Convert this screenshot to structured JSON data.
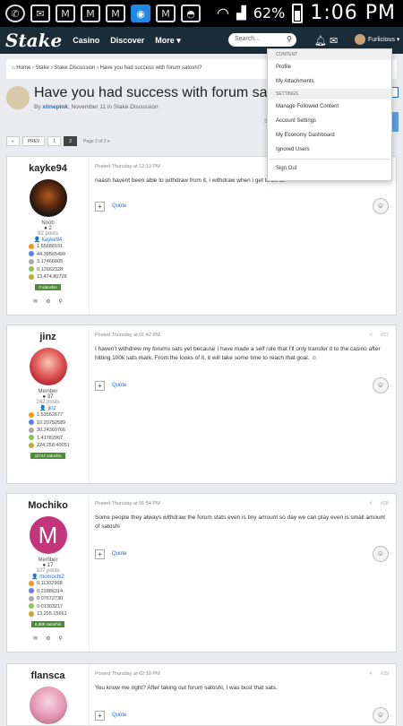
{
  "status_bar": {
    "icons": [
      "whatsapp-icon",
      "email-icon",
      "gmail-icon",
      "gmail-icon",
      "gmail-icon",
      "app-icon",
      "gmail-icon",
      "incognito-icon"
    ],
    "battery": "62%",
    "time": "1:06 PM"
  },
  "nav": {
    "logo": "Stake",
    "links": [
      "Casino",
      "Discover",
      "More ▾"
    ],
    "search_placeholder": "Search...",
    "username": "Furlicious ▾"
  },
  "dropdown": {
    "header_content": "CONTENT",
    "items_content": [
      "Profile",
      "My Attachments"
    ],
    "header_settings": "SETTINGS",
    "items_settings": [
      "Manage Followed Content",
      "Account Settings",
      "My Economy Dashboard",
      "Ignored Users"
    ],
    "signout": "Sign Out"
  },
  "breadcrumb": "⌂ Home  ›  Stake  ›  Stake Discussion  ›  Have you had success with forum satoshi?",
  "thread": {
    "title": "Have you had success with forum satoshi?",
    "by": "By ",
    "author": "xtinepink",
    "meta": ", November 11 in Stake Discussion",
    "ghost_s": "S"
  },
  "pagination": {
    "prev": "PREV",
    "pages": [
      "1",
      "2"
    ],
    "info": "Page 2 of 2 ▾",
    "back": "«"
  },
  "posts": [
    {
      "user": "kayke94",
      "role": "Noob",
      "rep": "● 2",
      "posts": "92 posts",
      "link": "kayke94",
      "crypto": [
        "1.65688191",
        "44.38565499",
        "3.17466005",
        "0.12662328",
        "13,474.80726"
      ],
      "sats": "0 satoshis",
      "time": "Posted Thursday at 12:19 PM",
      "body": "naash havent been able to withdraw from it, i withdraw when i get to 2k lol",
      "quote": "Quote",
      "num": "",
      "share": ""
    },
    {
      "user": "jinz",
      "role": "Member",
      "rep": "● 37",
      "posts": "242 posts",
      "link": "jinz",
      "crypto": [
        "1.53562677",
        "10.20750589",
        "30.24369766",
        "1.41782967",
        "224,258.40051"
      ],
      "sats": "42742 satoshis",
      "time": "Posted Thursday at 01:42 PM",
      "body": "I haven't withdrew my forums sats yet because I have made a self rule that I'll only transfer it to the casino after hitting 100k sats mark. From the looks of it, it will take some time to reach that goal. ☺",
      "quote": "Quote",
      "num": "#27",
      "share": "<"
    },
    {
      "user": "Mochiko",
      "role": "Member",
      "rep": "● 17",
      "posts": "127 posts",
      "link": "momochi2",
      "crypto": [
        "0.11302908",
        "0.22886314",
        "0.07672730",
        "0.01303217",
        "13,255.15661"
      ],
      "sats": "6,989 satoshis",
      "time": "Posted Thursday at 01:54 PM",
      "body": "Some people they always withdraw the forum stats even is tiny amount so day we can play even is small amount of satoshi",
      "quote": "Quote",
      "num": "#28",
      "share": "<"
    },
    {
      "user": "flansca",
      "time": "Posted Thursday at 02:10 PM",
      "body": "You know me right? After taking out forum satoshi, I was bust that sats.",
      "quote": "Quote",
      "num": "#29",
      "share": "<"
    }
  ],
  "mochiko_initial": "M",
  "colors": {
    "nav": "#1a2c38",
    "link": "#2a6ebb",
    "sats_badge": "#4e8b3a",
    "mochiko_avatar": "#c1367b"
  }
}
